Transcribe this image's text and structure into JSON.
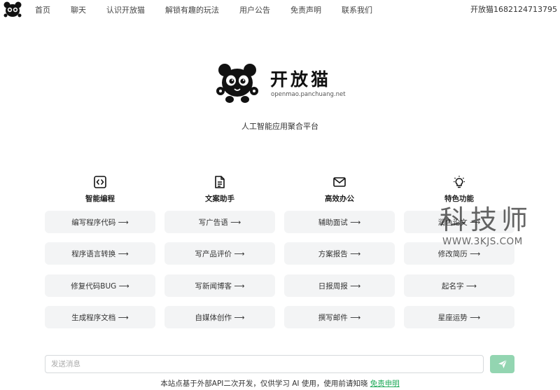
{
  "nav": {
    "links": [
      "首页",
      "聊天",
      "认识开放猫",
      "解锁有趣的玩法",
      "用户公告",
      "免责声明",
      "联系我们"
    ],
    "user_label": "开放猫1682124713795"
  },
  "brand": {
    "name": "开放猫",
    "domain": "openmao.panchuang.net",
    "tagline": "人工智能应用聚合平台"
  },
  "categories": [
    {
      "icon": "code-icon",
      "title": "智能编程",
      "items": [
        "编写程序代码 ⟶",
        "程序语言转换 ⟶",
        "修复代码BUG ⟶",
        "生成程序文档 ⟶"
      ]
    },
    {
      "icon": "document-icon",
      "title": "文案助手",
      "items": [
        "写广告语 ⟶",
        "写产品评价 ⟶",
        "写新闻博客 ⟶",
        "自媒体创作 ⟶"
      ]
    },
    {
      "icon": "mail-icon",
      "title": "高效办公",
      "items": [
        "辅助面试 ⟶",
        "方案报告 ⟶",
        "日报周报 ⟶",
        "撰写邮件 ⟶"
      ]
    },
    {
      "icon": "lightbulb-icon",
      "title": "特色功能",
      "items": [
        "润色论文 ⟶",
        "修改简历 ⟶",
        "起名字 ⟶",
        "星座运势 ⟶"
      ]
    }
  ],
  "watermark": {
    "text": "科技师",
    "url": "WWW.3KJS.COM"
  },
  "input": {
    "placeholder": "发送消息",
    "value": ""
  },
  "footer": {
    "text": "本站点基于外部API二次开发，仅供学习 AI 使用，使用前请知晓 ",
    "link": "免责申明"
  },
  "colors": {
    "accent": "#1faa59",
    "send_button": "#93d5b1",
    "button_bg": "#f3f4f5"
  }
}
